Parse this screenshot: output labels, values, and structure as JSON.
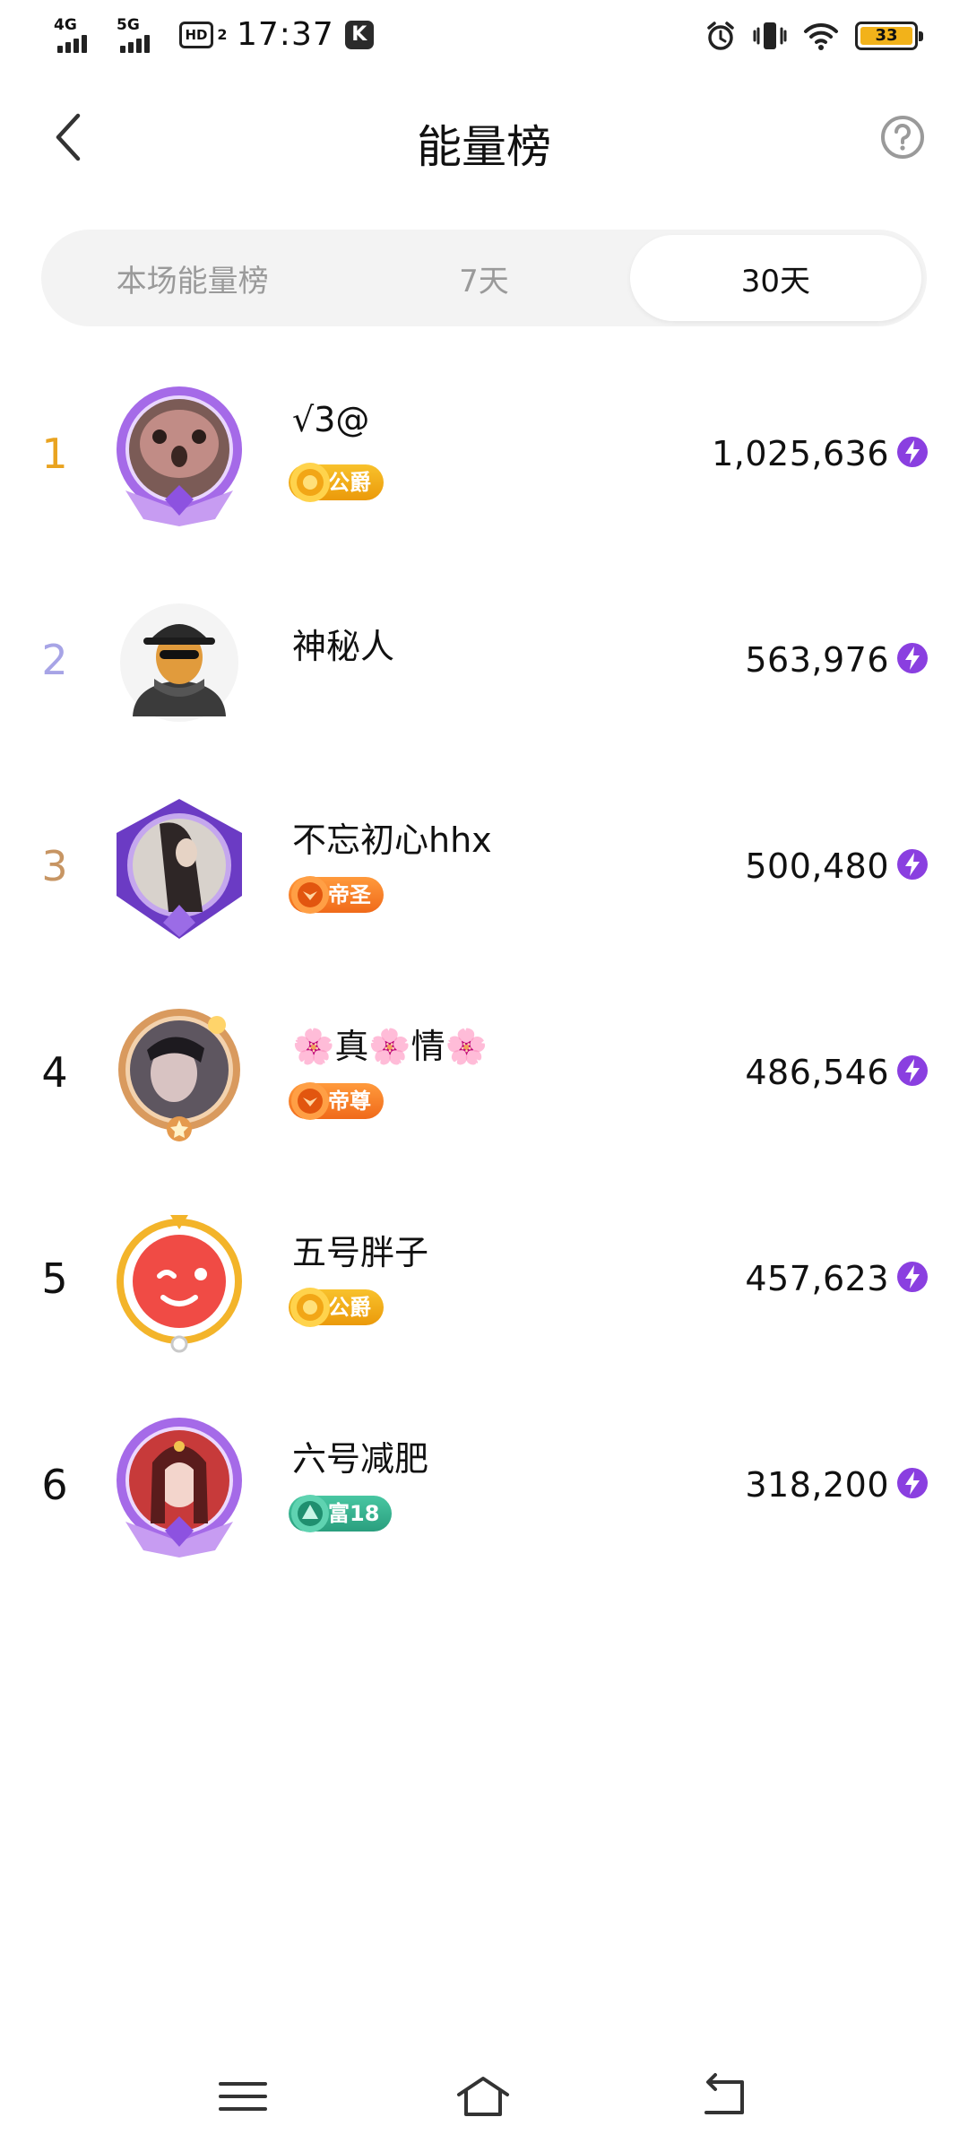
{
  "status_bar": {
    "network_1": "4G",
    "network_2": "5G",
    "hd_label": "HD",
    "hd_sub": "2",
    "time": "17:37",
    "k_badge": "K",
    "battery_level": "33"
  },
  "header": {
    "title": "能量榜"
  },
  "tabs": [
    {
      "label": "本场能量榜",
      "active": false
    },
    {
      "label": "7天",
      "active": false
    },
    {
      "label": "30天",
      "active": true
    }
  ],
  "ranking": [
    {
      "rank": "1",
      "name": "√3@",
      "badge": "公爵",
      "badge_style": "gold",
      "score": "1,025,636",
      "rank_color": "#e9a320"
    },
    {
      "rank": "2",
      "name": "神秘人",
      "badge": "",
      "badge_style": "",
      "score": "563,976",
      "rank_color": "#a7a4e6"
    },
    {
      "rank": "3",
      "name": "不忘初心hhx",
      "badge": "帝圣",
      "badge_style": "orange",
      "score": "500,480",
      "rank_color": "#c79563"
    },
    {
      "rank": "4",
      "name": "🌸真🌸情🌸",
      "badge": "帝尊",
      "badge_style": "orange",
      "score": "486,546",
      "rank_color": "#111111"
    },
    {
      "rank": "5",
      "name": "五号胖子",
      "badge": "公爵",
      "badge_style": "gold",
      "score": "457,623",
      "rank_color": "#111111"
    },
    {
      "rank": "6",
      "name": "六号减肥",
      "badge": "富18",
      "badge_style": "teal",
      "score": "318,200",
      "rank_color": "#111111"
    }
  ],
  "icons": {
    "back": "chevron-left-icon",
    "help": "question-mark-icon",
    "energy": "lightning-icon",
    "nav_menu": "menu-icon",
    "nav_home": "home-icon",
    "nav_back": "back-arrow-icon"
  },
  "colors": {
    "accent_purple": "#8a3fe0",
    "gold_badge": "#f0a814",
    "orange_badge": "#f07a22",
    "teal_badge": "#34b08d"
  }
}
